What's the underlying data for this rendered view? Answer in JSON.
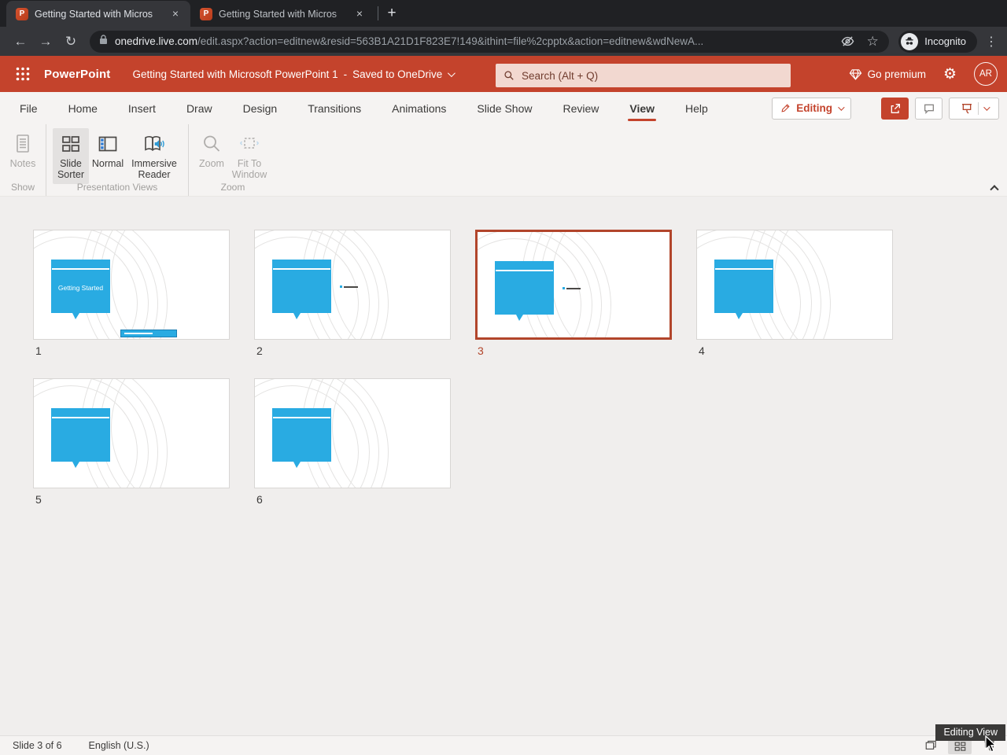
{
  "browser": {
    "tabs": [
      {
        "title": "Getting Started with Micros",
        "favicon_letter": "P",
        "close": "×"
      },
      {
        "title": "Getting Started with Micros",
        "favicon_letter": "P",
        "close": "×"
      }
    ],
    "new_tab_label": "+",
    "back": "←",
    "forward": "→",
    "reload": "↻",
    "url_host": "onedrive.live.com",
    "url_path": "/edit.aspx?action=editnew&resid=563B1A21D1F823E7!149&ithint=file%2cpptx&action=editnew&wdNewA...",
    "star": "☆",
    "incognito_label": "Incognito",
    "menu_dots": "⋮"
  },
  "header": {
    "app_name": "PowerPoint",
    "doc_title": "Getting Started with Microsoft PowerPoint 1",
    "title_separator": "-",
    "save_status": "Saved to OneDrive",
    "search_placeholder": "Search (Alt + Q)",
    "premium_label": "Go premium",
    "gear": "⚙",
    "avatar_initials": "AR"
  },
  "menu": {
    "items": [
      "File",
      "Home",
      "Insert",
      "Draw",
      "Design",
      "Transitions",
      "Animations",
      "Slide Show",
      "Review",
      "View",
      "Help"
    ],
    "active_item": "View",
    "editing_label": "Editing"
  },
  "ribbon": {
    "groups": [
      {
        "label": "Show",
        "buttons": [
          {
            "label": "Notes",
            "disabled": true
          }
        ]
      },
      {
        "label": "Presentation Views",
        "buttons": [
          {
            "label": "Slide Sorter",
            "active": true
          },
          {
            "label": "Normal"
          },
          {
            "label": "Immersive Reader"
          }
        ]
      },
      {
        "label": "Zoom",
        "buttons": [
          {
            "label": "Zoom",
            "disabled": true
          },
          {
            "label": "Fit To Window",
            "disabled": true
          }
        ]
      }
    ]
  },
  "slides": [
    {
      "number": "1",
      "title": "Getting Started",
      "selected": false
    },
    {
      "number": "2",
      "selected": false
    },
    {
      "number": "3",
      "selected": true
    },
    {
      "number": "4",
      "selected": false
    },
    {
      "number": "5",
      "selected": false
    },
    {
      "number": "6",
      "selected": false
    }
  ],
  "statusbar": {
    "slide_info": "Slide 3 of 6",
    "language": "English (U.S.)",
    "tooltip": "Editing View"
  },
  "colors": {
    "accent": "#C4432C",
    "slide_cyan": "#29ABE2",
    "selection": "#B2452B"
  }
}
